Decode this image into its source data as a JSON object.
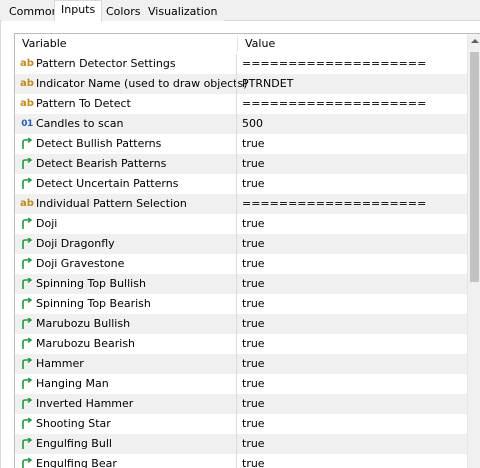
{
  "tabs": [
    {
      "label": "Common"
    },
    {
      "label": "Inputs"
    },
    {
      "label": "Colors"
    },
    {
      "label": "Visualization"
    }
  ],
  "active_tab": "Inputs",
  "grid": {
    "columns": {
      "variable": "Variable",
      "value": "Value"
    },
    "rows": [
      {
        "icon": "string-icon",
        "name": "Pattern Detector Settings",
        "value": "===================="
      },
      {
        "icon": "string-icon",
        "name": "Indicator Name (used to draw objects)",
        "value": "PTRNDET"
      },
      {
        "icon": "string-icon",
        "name": "Pattern To Detect",
        "value": "===================="
      },
      {
        "icon": "integer-icon",
        "name": "Candles to scan",
        "value": "500"
      },
      {
        "icon": "bool-arrow-icon",
        "name": "Detect Bullish Patterns",
        "value": "true"
      },
      {
        "icon": "bool-arrow-icon",
        "name": "Detect Bearish Patterns",
        "value": "true"
      },
      {
        "icon": "bool-arrow-icon",
        "name": "Detect Uncertain Patterns",
        "value": "true"
      },
      {
        "icon": "string-icon",
        "name": "Individual Pattern Selection",
        "value": "===================="
      },
      {
        "icon": "bool-arrow-icon",
        "name": "Doji",
        "value": "true"
      },
      {
        "icon": "bool-arrow-icon",
        "name": "Doji Dragonfly",
        "value": "true"
      },
      {
        "icon": "bool-arrow-icon",
        "name": "Doji Gravestone",
        "value": "true"
      },
      {
        "icon": "bool-arrow-icon",
        "name": "Spinning Top Bullish",
        "value": "true"
      },
      {
        "icon": "bool-arrow-icon",
        "name": "Spinning Top Bearish",
        "value": "true"
      },
      {
        "icon": "bool-arrow-icon",
        "name": "Marubozu Bullish",
        "value": "true"
      },
      {
        "icon": "bool-arrow-icon",
        "name": "Marubozu Bearish",
        "value": "true"
      },
      {
        "icon": "bool-arrow-icon",
        "name": "Hammer",
        "value": "true"
      },
      {
        "icon": "bool-arrow-icon",
        "name": "Hanging Man",
        "value": "true"
      },
      {
        "icon": "bool-arrow-icon",
        "name": "Inverted Hammer",
        "value": "true"
      },
      {
        "icon": "bool-arrow-icon",
        "name": "Shooting Star",
        "value": "true"
      },
      {
        "icon": "bool-arrow-icon",
        "name": "Engulfing Bull",
        "value": "true"
      },
      {
        "icon": "bool-arrow-icon",
        "name": "Engulfing Bear",
        "value": "true"
      }
    ]
  },
  "colors": {
    "row_alt": "#f0f0f0",
    "string_icon": "#c08a20",
    "integer_icon": "#2a5db0",
    "bool_icon": "#1e9a3c"
  }
}
